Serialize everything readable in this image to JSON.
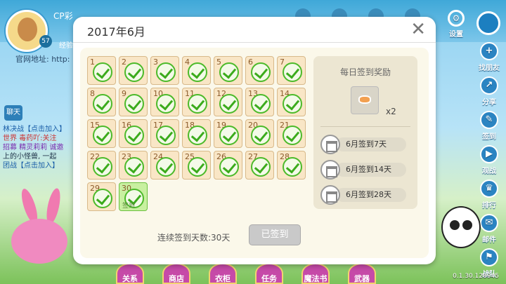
{
  "player": {
    "name": "CP彩",
    "level": "57",
    "exp_label": "经验",
    "site_text": "官网地址: http:"
  },
  "chat": {
    "tab_label": "聊天",
    "lines": [
      "林决战【点击加入】",
      "世界 毒药吖:关注",
      "招募 精灵莉莉 诚邀",
      "上的小怪兽, 一起",
      "团战【点击加入】"
    ]
  },
  "top_menu": {
    "settings_label": "设置"
  },
  "right_menu": [
    {
      "label": "找朋友"
    },
    {
      "label": "分享"
    },
    {
      "label": "签到"
    },
    {
      "label": "观战"
    },
    {
      "label": "排行"
    },
    {
      "label": "邮件"
    },
    {
      "label": "战队"
    }
  ],
  "bottom_menu": [
    "关系",
    "商店",
    "衣柜",
    "任务",
    "魔法书",
    "武器"
  ],
  "version": "0.1.30.128945",
  "dialog": {
    "title": "2017年6月",
    "close": "✕",
    "days": [
      1,
      2,
      3,
      4,
      5,
      6,
      7,
      8,
      9,
      10,
      11,
      12,
      13,
      14,
      15,
      16,
      17,
      18,
      19,
      20,
      21,
      22,
      23,
      24,
      25,
      26,
      27,
      28,
      29,
      30
    ],
    "today": 30,
    "today_stamp": "签到",
    "streak_text": "连续签到天数:30天",
    "signed_button": "已签到",
    "reward": {
      "title": "每日签到奖励",
      "quantity": "x2",
      "milestones": [
        "6月签到7天",
        "6月签到14天",
        "6月签到28天"
      ]
    }
  }
}
